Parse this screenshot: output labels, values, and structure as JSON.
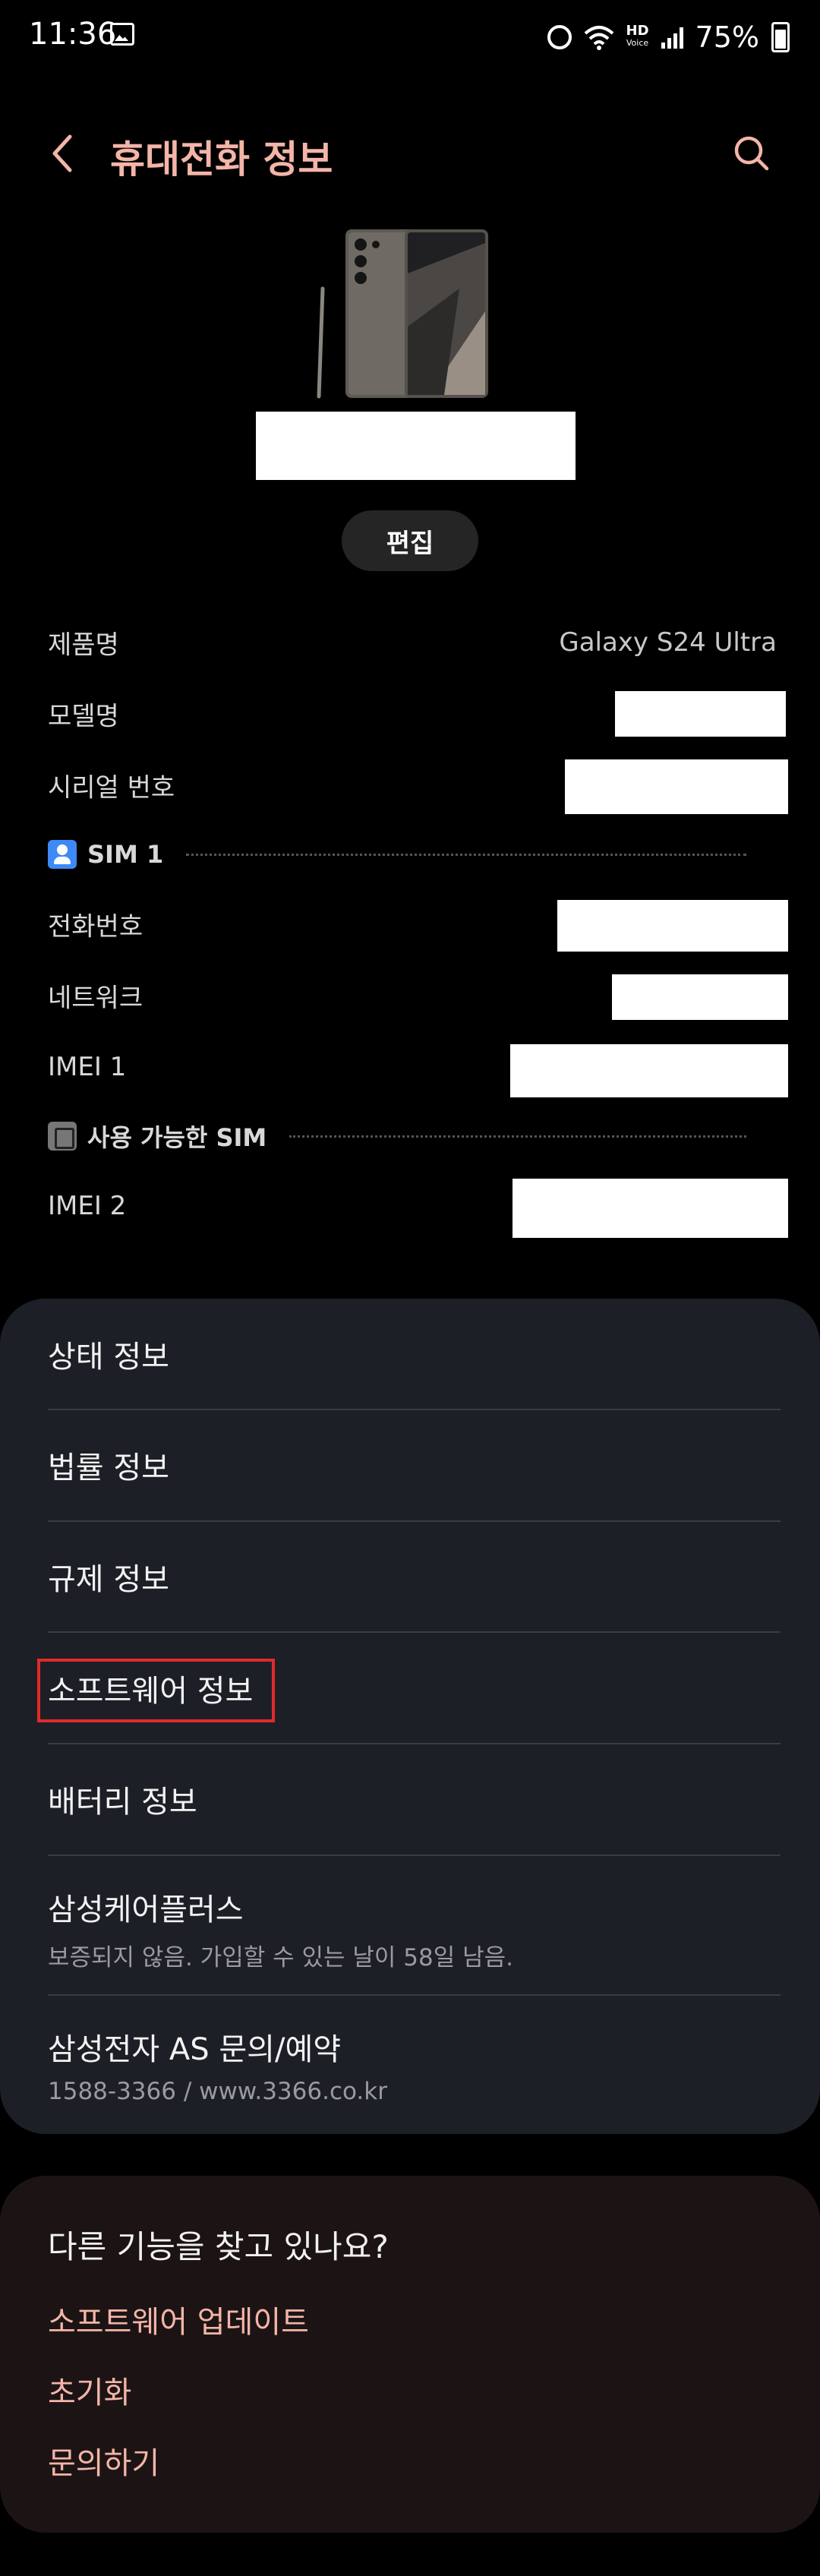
{
  "status_bar": {
    "time": "11:36",
    "battery": "75%",
    "hd_label": "HD",
    "hd_sub": "Voice",
    "icons": [
      "gallery-icon",
      "alarm-icon",
      "wifi-icon",
      "hd-voice-icon",
      "signal-icon",
      "battery-icon"
    ]
  },
  "app_bar": {
    "title": "휴대전화 정보",
    "back_icon": "chevron-left-icon",
    "search_icon": "search-icon"
  },
  "device": {
    "edit_label": "편집"
  },
  "info": {
    "rows": [
      {
        "label": "제품명",
        "value": "Galaxy S24 Ultra"
      },
      {
        "label": "모델명",
        "value": ""
      },
      {
        "label": "시리얼 번호",
        "value": ""
      },
      {
        "label": "전화번호",
        "value": ""
      },
      {
        "label": "네트워크",
        "value": ""
      },
      {
        "label": "IMEI 1",
        "value": ""
      },
      {
        "label": "IMEI 2",
        "value": ""
      }
    ],
    "sim1_label": "SIM 1",
    "sim2_label": "사용 가능한 SIM"
  },
  "menu": {
    "items": [
      {
        "label": "상태 정보"
      },
      {
        "label": "법률 정보"
      },
      {
        "label": "규제 정보"
      },
      {
        "label": "소프트웨어 정보"
      },
      {
        "label": "배터리 정보"
      },
      {
        "label": "삼성케어플러스",
        "sub": "보증되지 않음. 가입할 수 있는 날이 58일 남음."
      },
      {
        "label": "삼성전자 AS 문의/예약",
        "sub": "1588-3366 / www.3366.co.kr"
      }
    ]
  },
  "help": {
    "title": "다른 기능을 찾고 있나요?",
    "links": [
      "소프트웨어 업데이트",
      "초기화",
      "문의하기"
    ]
  },
  "colors": {
    "accent": "#f4b5a8",
    "card_bg": "#1d1f26",
    "help_bg": "#1c1414",
    "highlight": "#e02a2a",
    "sim_blue": "#3d8af7"
  }
}
